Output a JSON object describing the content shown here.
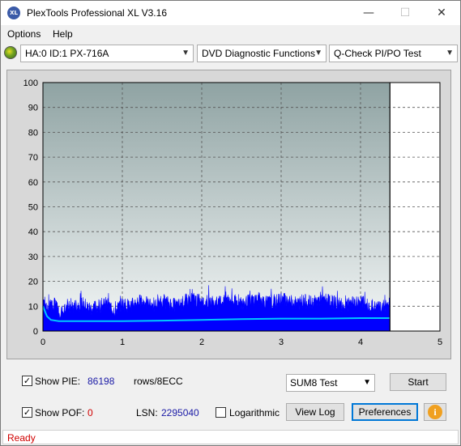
{
  "window": {
    "title": "PlexTools Professional XL V3.16",
    "icon_label": "XL",
    "minimize": "—",
    "maximize": "☐",
    "close": "✕"
  },
  "menu": {
    "options_label": "Options",
    "help_label": "Help"
  },
  "toolbar": {
    "drive": "HA:0 ID:1  PX-716A",
    "function": "DVD Diagnostic Functions",
    "test": "Q-Check PI/PO Test"
  },
  "chart_data": {
    "type": "area",
    "x_ticks": [
      "0",
      "1",
      "2",
      "3",
      "4",
      "5"
    ],
    "y_ticks": [
      "0",
      "10",
      "20",
      "30",
      "40",
      "50",
      "60",
      "70",
      "80",
      "90",
      "100"
    ],
    "xlim": [
      0,
      5
    ],
    "ylim": [
      0,
      100
    ],
    "data_end_x": 4.37,
    "series": [
      {
        "color": "#0000ff",
        "x": [
          0,
          0.05,
          0.1,
          0.15,
          0.2,
          0.3,
          0.4,
          0.5,
          0.6,
          0.7,
          0.8,
          0.9,
          1.0,
          1.1,
          1.2,
          1.3,
          1.4,
          1.5,
          1.6,
          1.7,
          1.8,
          1.9,
          2.0,
          2.1,
          2.2,
          2.3,
          2.4,
          2.5,
          2.6,
          2.7,
          2.8,
          2.9,
          3.0,
          3.1,
          3.2,
          3.3,
          3.4,
          3.5,
          3.6,
          3.7,
          3.8,
          3.9,
          4.0,
          4.1,
          4.2,
          4.3,
          4.37
        ],
        "y": [
          14,
          9,
          11,
          12,
          8,
          10,
          11,
          12,
          10,
          11,
          12,
          9,
          12,
          11,
          13,
          12,
          11,
          13,
          12,
          11,
          13,
          14,
          12,
          13,
          12,
          14,
          13,
          12,
          13,
          14,
          13,
          12,
          14,
          13,
          12,
          13,
          12,
          14,
          13,
          12,
          11,
          12,
          13,
          11,
          10,
          11,
          12
        ]
      },
      {
        "color": "#00c8ff",
        "x": [
          0,
          0.05,
          0.1,
          0.2,
          0.5,
          1.0,
          1.5,
          2.0,
          2.5,
          3.0,
          3.5,
          4.0,
          4.37
        ],
        "y": [
          10,
          6,
          4.5,
          4,
          4,
          4,
          4.2,
          4.5,
          4.8,
          5,
          5,
          5.2,
          5.2
        ]
      }
    ]
  },
  "controls": {
    "show_pie_label": "Show PIE:",
    "show_pie_checked": "✓",
    "pie_value": "86198",
    "rows_unit": "rows/8ECC",
    "show_pof_label": "Show POF:",
    "show_pof_checked": "✓",
    "pof_value": "0",
    "lsn_label": "LSN:",
    "lsn_value": "2295040",
    "logarithmic_label": "Logarithmic",
    "sum_test": "SUM8 Test",
    "start_label": "Start",
    "view_log_label": "View Log",
    "preferences_label": "Preferences",
    "info_glyph": "i"
  },
  "status": {
    "text": "Ready"
  }
}
